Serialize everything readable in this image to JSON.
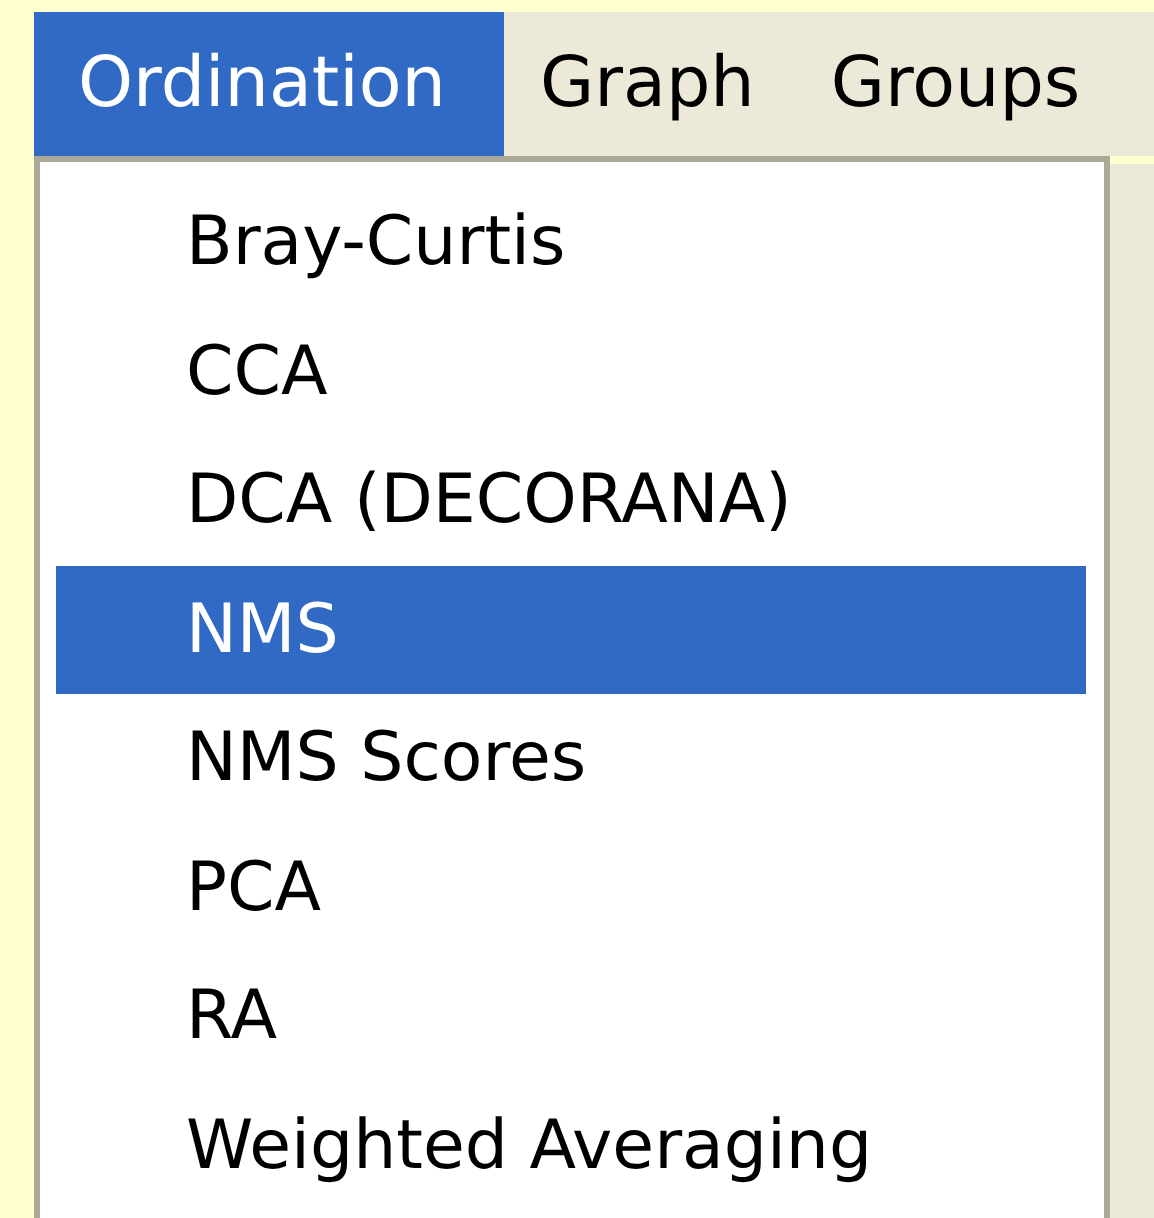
{
  "menu_bar": [
    {
      "label": "Ordination",
      "selected": true
    },
    {
      "label": "Graph",
      "selected": false
    },
    {
      "label": "Groups",
      "selected": false
    }
  ],
  "dropdown": [
    {
      "label": "Bray-Curtis",
      "selected": false
    },
    {
      "label": "CCA",
      "selected": false
    },
    {
      "label": "DCA (DECORANA)",
      "selected": false
    },
    {
      "label": "NMS",
      "selected": true
    },
    {
      "label": "NMS Scores",
      "selected": false
    },
    {
      "label": "PCA",
      "selected": false
    },
    {
      "label": "RA",
      "selected": false
    },
    {
      "label": "Weighted Averaging",
      "selected": false
    }
  ]
}
